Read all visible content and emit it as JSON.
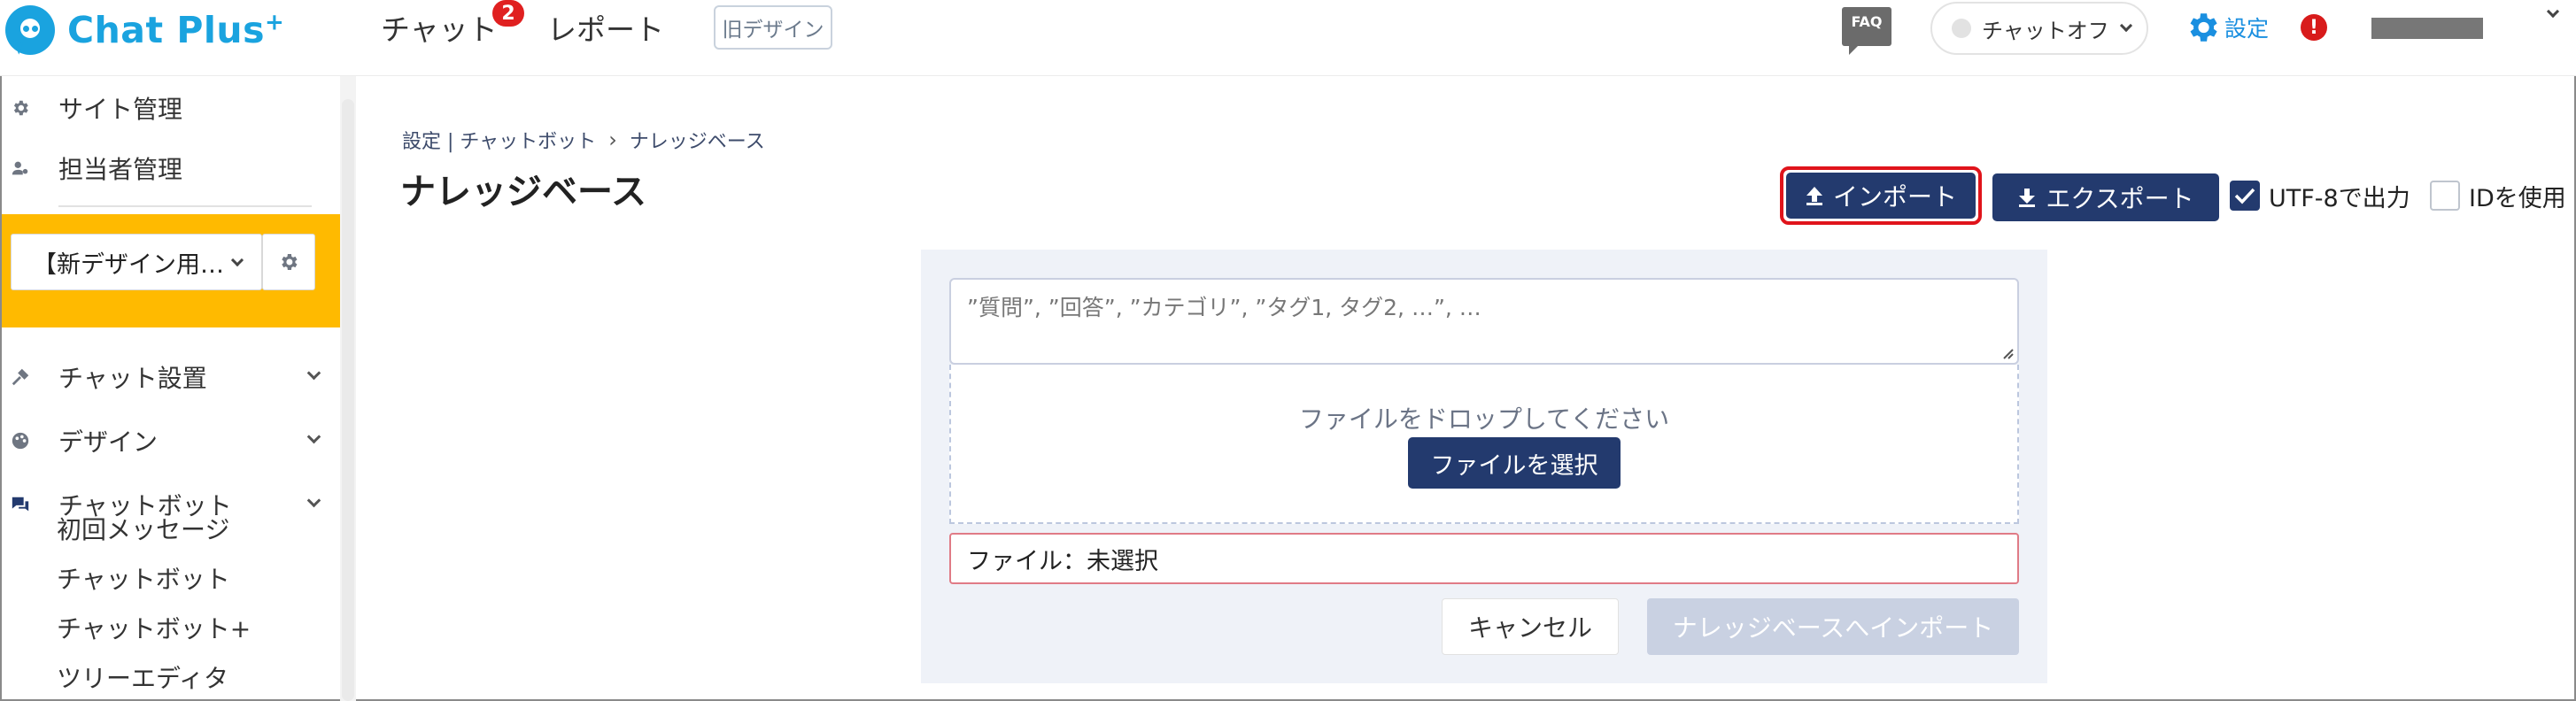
{
  "header": {
    "logo_text": "Chat Plus",
    "logo_sup": "+",
    "nav_chat": "チャット",
    "nav_chat_badge": "2",
    "nav_report": "レポート",
    "old_design": "旧デザイン",
    "faq": "FAQ",
    "chat_status": "チャットオフ",
    "settings": "設定",
    "alert": "!"
  },
  "sidebar": {
    "site_manage": "サイト管理",
    "staff_manage": "担当者管理",
    "site_select": "【新デザイン用…",
    "chat_settings": "チャット設置",
    "design": "デザイン",
    "chatbot": "チャットボット",
    "sub_items": [
      "初回メッセージ",
      "チャットボット",
      "チャットボット+",
      "ツリーエディタ"
    ]
  },
  "main": {
    "breadcrumb_1": "設定 | チャットボット",
    "breadcrumb_sep": "›",
    "breadcrumb_2": "ナレッジベース",
    "title": "ナレッジベース",
    "import_label": "インポート",
    "export_label": "エクスポート",
    "utf8_label": "UTF-8で出力",
    "utf8_checked": true,
    "useid_label": "IDを使用",
    "useid_checked": false,
    "textarea_placeholder": "”質問”, ”回答”, ”カテゴリ”, ”タグ1, タグ2, …”, …",
    "drop_text": "ファイルをドロップしてください",
    "select_file": "ファイルを選択",
    "file_status": "ファイル：未選択",
    "cancel": "キャンセル",
    "submit": "ナレッジベースへインポート"
  },
  "colors": {
    "brand": "#1aa3df",
    "primary_button": "#233a6e",
    "highlight": "#e0141b",
    "sidebar_accent": "#ffba00",
    "disabled_button": "#c9d1e2"
  }
}
